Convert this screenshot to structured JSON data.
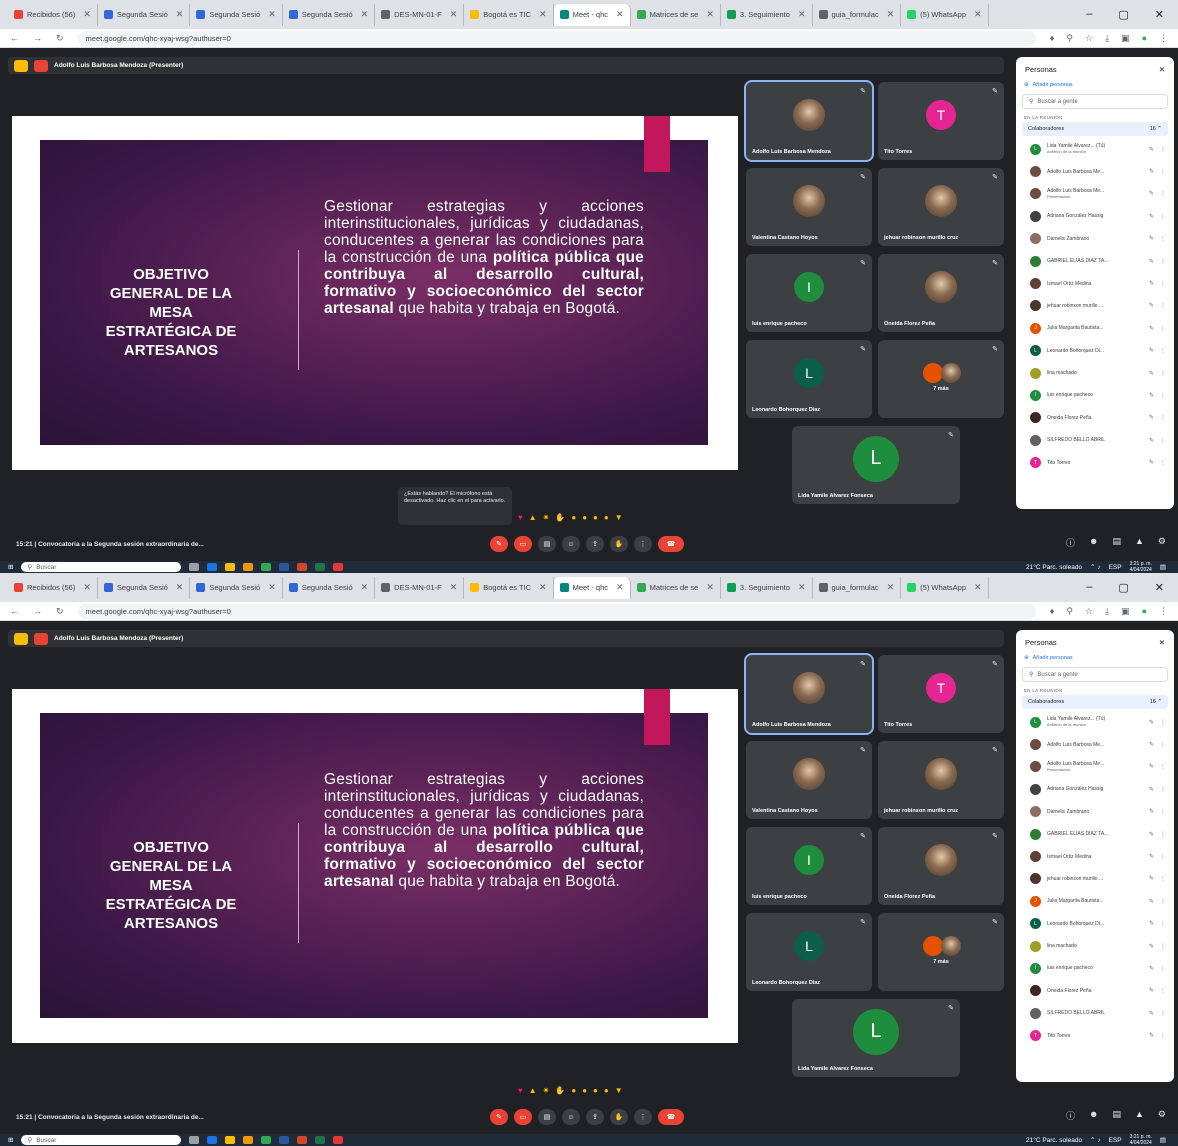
{
  "tabs": [
    {
      "label": "Recibidos (56)",
      "color": "#ea4335",
      "active": false
    },
    {
      "label": "Segunda Sesió",
      "color": "#3367d6",
      "active": false
    },
    {
      "label": "Segunda Sesió",
      "color": "#3367d6",
      "active": false
    },
    {
      "label": "Segunda Sesió",
      "color": "#3367d6",
      "active": false
    },
    {
      "label": "DES-MN-01-F",
      "color": "#5f6368",
      "active": false
    },
    {
      "label": "Bogotá es TIC",
      "color": "#fbbc04",
      "active": false
    },
    {
      "label": "Meet - qhc",
      "color": "#00897b",
      "active": true
    },
    {
      "label": "Matrices de se",
      "color": "#34a853",
      "active": false
    },
    {
      "label": "3. Seguimiento",
      "color": "#0f9d58",
      "active": false
    },
    {
      "label": "guia_formulac",
      "color": "#5f6368",
      "active": false
    },
    {
      "label": "(5) WhatsApp",
      "color": "#25d366",
      "active": false
    }
  ],
  "address": "meet.google.com/qhc-xyaj-wsg?authuser=0",
  "presenter": "Adolfo Luis Barbosa Mendoza (Presenter)",
  "slide": {
    "title": "OBJETIVO GENERAL DE LA MESA ESTRATÉGICA DE ARTESANOS",
    "body_1": "Gestionar estrategias y acciones interinstitucionales, jurídicas y ciudadanas, conducentes a generar las condiciones para la construcción de una ",
    "body_bold_1": "política pública que contribuya al desarrollo cultural, formativo y socioeconómico del sector artesanal",
    "body_2": " que habita y trabaja en Bogotá."
  },
  "tiles_a": [
    {
      "name": "Adolfo Luis Barbosa Mendoza",
      "kind": "photo"
    },
    {
      "name": "Tito Torres",
      "kind": "avatar",
      "letter": "T",
      "color": "#e52592"
    },
    {
      "name": "Valentina Castano Hoyos",
      "kind": "photo"
    },
    {
      "name": "jehuar robinson murillo cruz",
      "kind": "photo"
    },
    {
      "name": "luis enrique pacheco",
      "kind": "avatar",
      "letter": "I",
      "color": "#1e8e3e"
    },
    {
      "name": "Oneida Florez Peña",
      "kind": "photo"
    },
    {
      "name": "Leonardo Bohorquez Diaz",
      "kind": "avatar",
      "letter": "L",
      "color": "#0b5e4a"
    },
    {
      "name": "7 más",
      "kind": "more"
    }
  ],
  "big_tile": {
    "name": "Lida Yamile Alvarez Fonseca",
    "letter": "L",
    "color": "#1e8e3e"
  },
  "tooltip": "¿Estás hablando? El micrófono está desactivado. Haz clic en el para activarlo.",
  "meeting_time": "15:21",
  "meeting_title": "Convocatoria a la Segunda sesión extraordinaria de...",
  "people": {
    "title": "Personas",
    "add": "Añadir personas",
    "search": "Buscar a gente",
    "section": "EN LA REUNIÓN",
    "group": "Colaboradores",
    "count": "16",
    "list": [
      {
        "name": "Lida Yamile Alvarez... (Tú)",
        "sub": "Anfitrión de la reunión",
        "color": "#1e8e3e",
        "letter": "L"
      },
      {
        "name": "Adolfo Luis Barbosa Me...",
        "color": "#6d4c41",
        "letter": ""
      },
      {
        "name": "Adolfo Luis Barbosa Me...",
        "sub": "Presentación",
        "color": "#6d4c41",
        "letter": ""
      },
      {
        "name": "Adriana González Hassig",
        "color": "#424242",
        "letter": ""
      },
      {
        "name": "Damelis Zambrano",
        "color": "#8d6e63",
        "letter": ""
      },
      {
        "name": "GABRIEL ELIAS DIAZ TA...",
        "color": "#2e7d32",
        "letter": ""
      },
      {
        "name": "Ismael Ortiz Medina",
        "color": "#5d4037",
        "letter": ""
      },
      {
        "name": "jehuar robinson murillo ...",
        "color": "#4e342e",
        "letter": ""
      },
      {
        "name": "Julia Margarita Bautista...",
        "color": "#e65100",
        "letter": "J"
      },
      {
        "name": "Leonardo Bohorquez Di...",
        "color": "#0b5e4a",
        "letter": "L"
      },
      {
        "name": "lina machado",
        "color": "#9e9d24",
        "letter": ""
      },
      {
        "name": "luis enrique pacheco",
        "color": "#1e8e3e",
        "letter": "I"
      },
      {
        "name": "Oneida Florez Peña",
        "color": "#3e2723",
        "letter": ""
      },
      {
        "name": "SILFREDO BELLO ABRIL",
        "color": "#616161",
        "letter": ""
      },
      {
        "name": "Tito Torres",
        "color": "#e52592",
        "letter": "T"
      }
    ]
  },
  "taskbar": {
    "search": "Buscar",
    "weather": "21°C Parc. soleado",
    "lang": "ESP",
    "time": "3:21 p. m.",
    "date": "4/04/2024"
  }
}
